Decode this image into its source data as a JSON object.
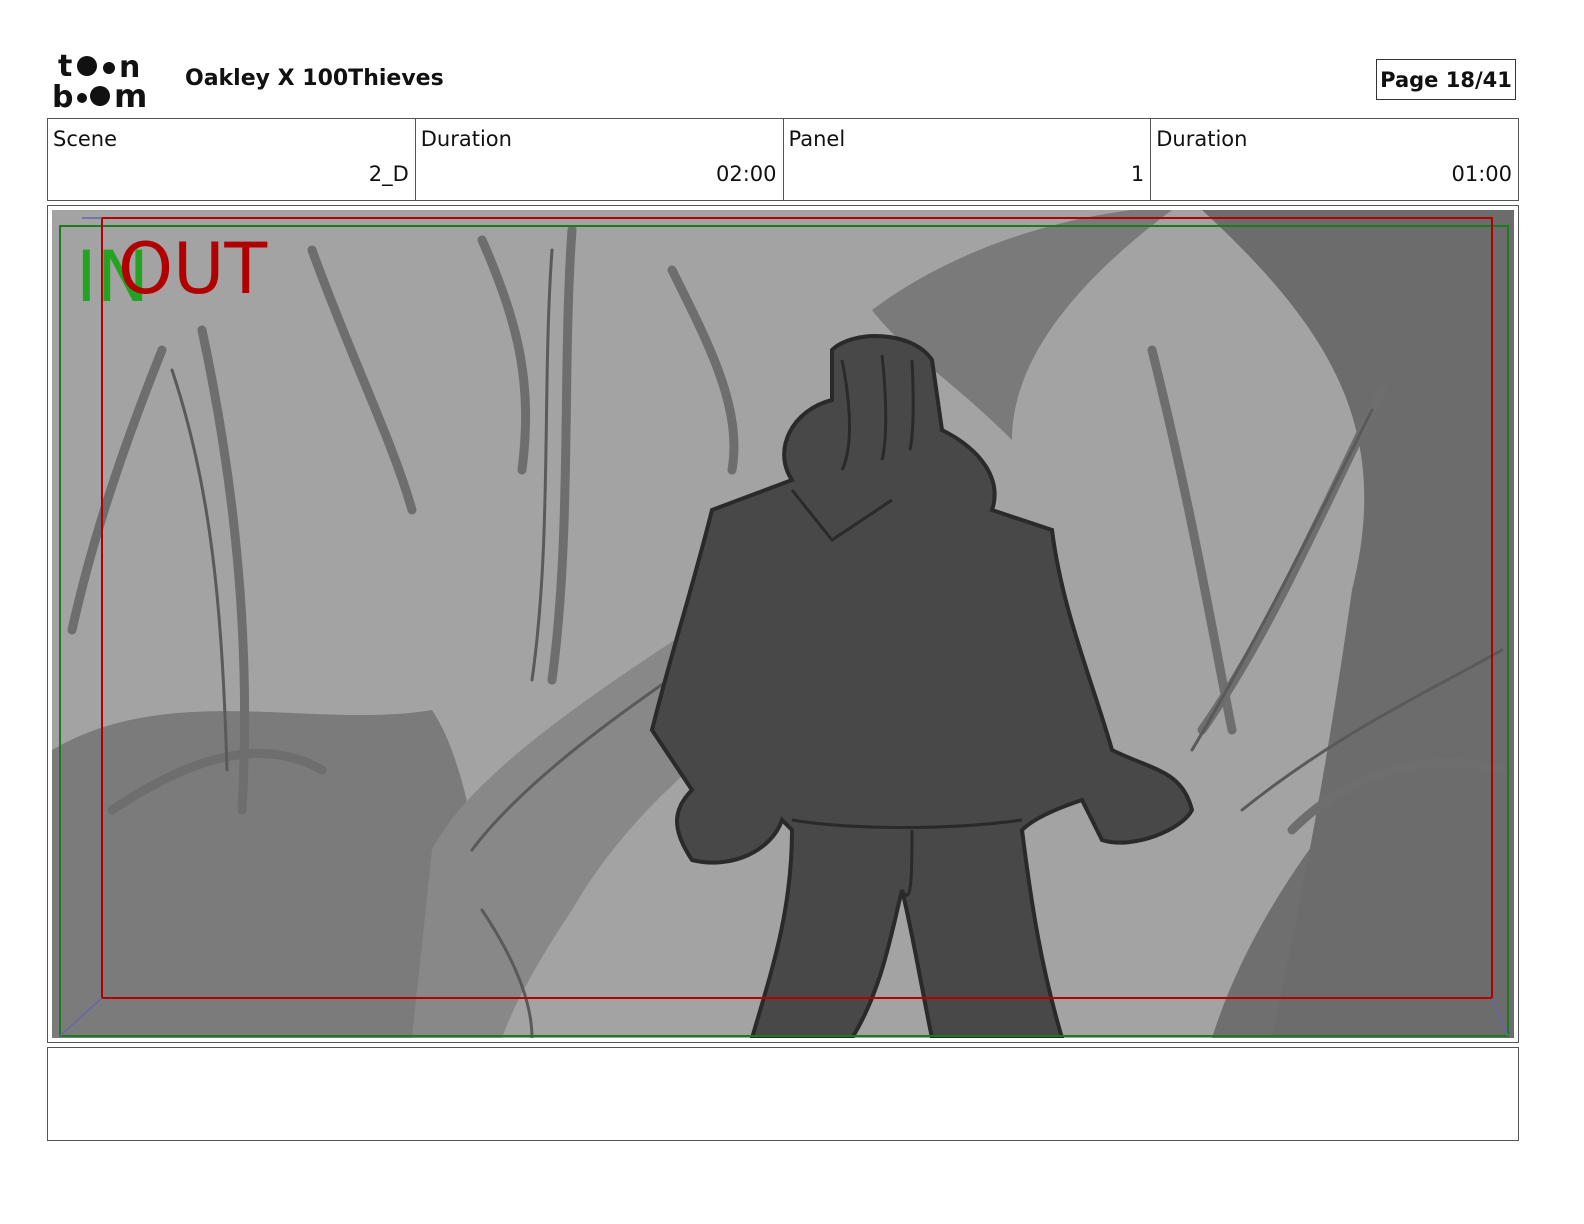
{
  "header": {
    "logo_text": "toon boom",
    "project_title": "Oakley X 100Thieves",
    "page_label": "Page 18/41"
  },
  "info": {
    "scene_label": "Scene",
    "scene_value": "2_D",
    "scene_duration_label": "Duration",
    "scene_duration_value": "02:00",
    "panel_label": "Panel",
    "panel_value": "1",
    "panel_duration_label": "Duration",
    "panel_duration_value": "01:00"
  },
  "panel": {
    "in_marker": "IN",
    "out_marker": "OUT",
    "in_color": "#22a322",
    "out_color": "#b00000"
  },
  "notes": {
    "text": ""
  }
}
